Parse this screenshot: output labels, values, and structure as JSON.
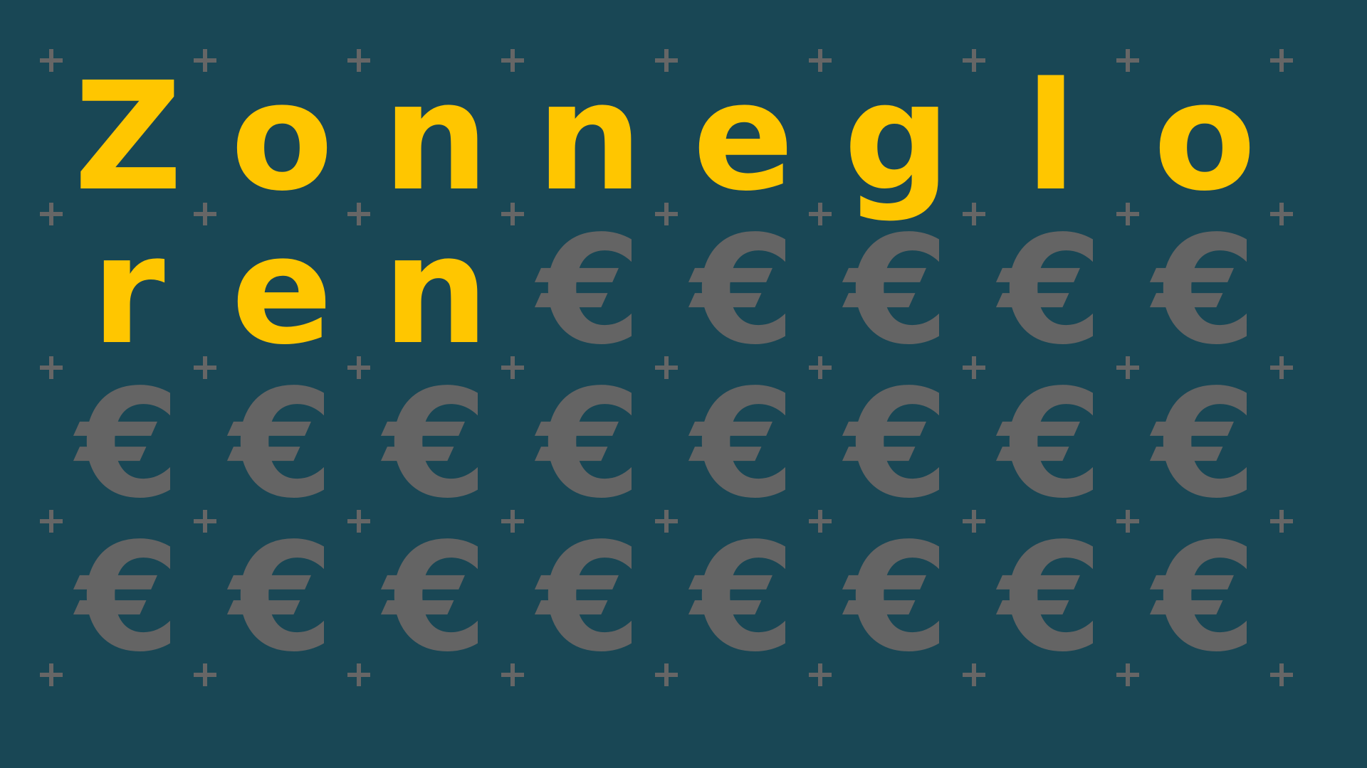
{
  "title_letters": [
    "Z",
    "o",
    "n",
    "n",
    "e",
    "g",
    "l",
    "o",
    "r",
    "e",
    "n"
  ],
  "symbol": "€",
  "colors": {
    "background": "#194755",
    "title": "#FFC600",
    "symbol": "#646464",
    "plus": "#666666"
  },
  "grid": {
    "columns": 8,
    "rows": 4
  }
}
